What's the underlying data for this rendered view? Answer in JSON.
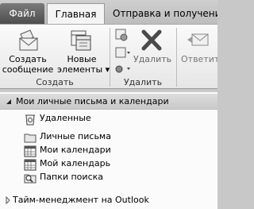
{
  "tabs": {
    "file": "Файл",
    "home": "Главная",
    "send_receive": "Отправка и получение"
  },
  "ribbon": {
    "create_message": "Создать сообщение",
    "new_items": "Новые элементы",
    "create_group": "Создать",
    "delete": "Удалить",
    "delete_group": "Удалить",
    "reply": "Ответить"
  },
  "nav": {
    "header": "Мои личные письма и календари",
    "items": [
      {
        "label": "Удаленные",
        "icon": "deleted-items-icon"
      },
      {
        "label": "Личные письма",
        "icon": "folder-icon"
      },
      {
        "label": "Мои календари",
        "icon": "calendar-icon"
      },
      {
        "label": "Мой календарь",
        "icon": "calendar-icon"
      },
      {
        "label": "Папки поиска",
        "icon": "search-folder-icon"
      }
    ],
    "footer": "Тайм-менеджмент на Outlook"
  }
}
